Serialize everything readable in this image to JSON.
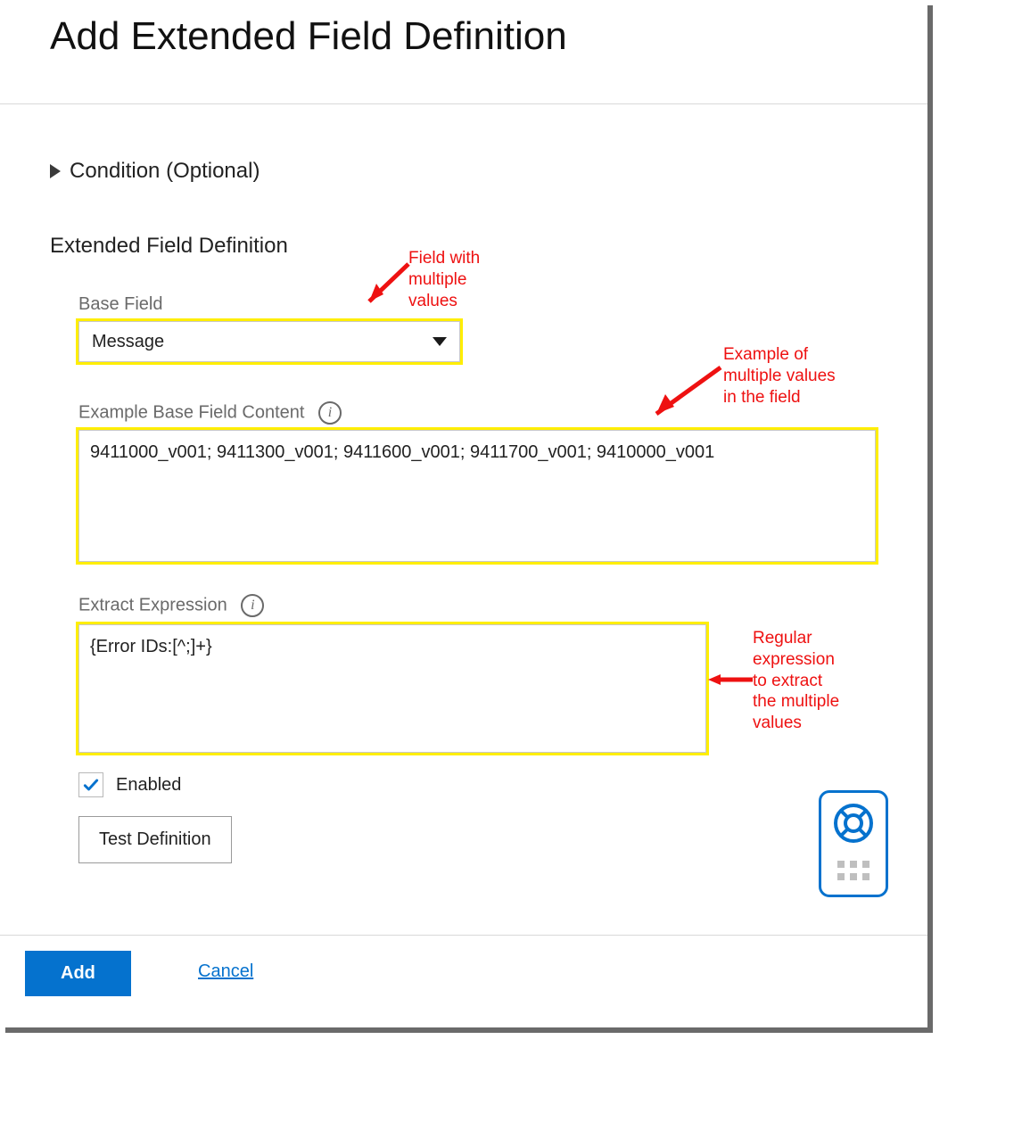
{
  "header": {
    "title": "Add Extended Field Definition"
  },
  "condition": {
    "label": "Condition (Optional)"
  },
  "section": {
    "title": "Extended Field Definition"
  },
  "base_field": {
    "label": "Base Field",
    "value": "Message"
  },
  "example_content": {
    "label": "Example Base Field Content",
    "value": "9411000_v001; 9411300_v001; 9411600_v001; 9411700_v001; 9410000_v001"
  },
  "extract_expression": {
    "label": "Extract Expression",
    "value": "{Error IDs:[^;]+}"
  },
  "enabled": {
    "label": "Enabled",
    "checked": true
  },
  "buttons": {
    "test": "Test Definition",
    "add": "Add",
    "cancel": "Cancel"
  },
  "annotations": {
    "a1": "Field with\nmultiple\nvalues",
    "a2": "Example of\nmultiple values\nin the field",
    "a3": "Regular\nexpression\nto extract\nthe multiple\nvalues"
  },
  "colors": {
    "accent": "#0572ce",
    "highlight": "#ffee00",
    "annotation": "#ee1111"
  }
}
